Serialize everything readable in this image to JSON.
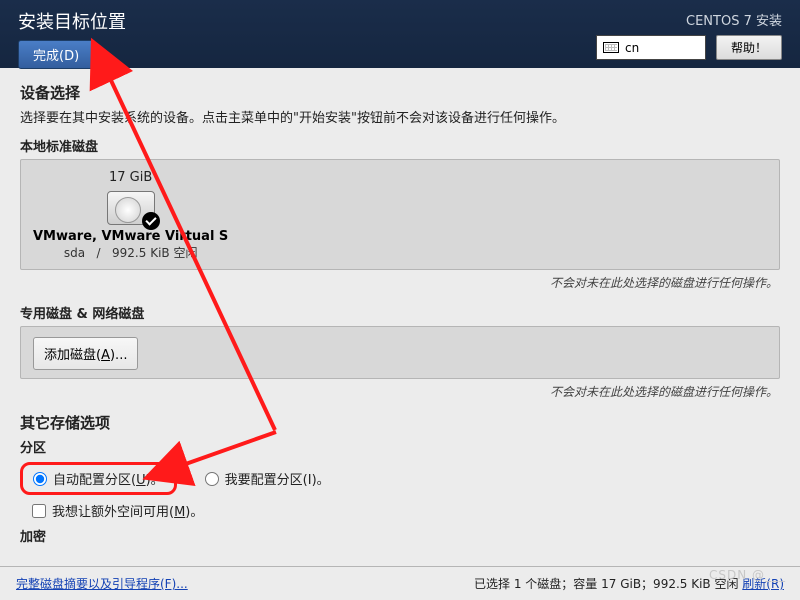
{
  "header": {
    "title": "安装目标位置",
    "done": "完成(D)",
    "subtitle": "CENTOS 7 安装",
    "lang": "cn",
    "help": "帮助！"
  },
  "device": {
    "head": "设备选择",
    "desc": "选择要在其中安装系统的设备。点击主菜单中的\"开始安装\"按钮前不会对该设备进行任何操作。",
    "local_head": "本地标准磁盘",
    "disk_size": "17 GiB",
    "disk_name": "VMware, VMware Virtual S",
    "disk_dev": "sda",
    "disk_sep": "/",
    "disk_free": "992.5 KiB 空闲",
    "note": "不会对未在此处选择的磁盘进行任何操作。",
    "net_head": "专用磁盘 & 网络磁盘",
    "add_label_pre": "添加磁盘(",
    "add_key": "A",
    "add_label_post": ")..."
  },
  "other": {
    "head": "其它存储选项",
    "part": "分区",
    "auto_pre": "自动配置分区(",
    "auto_key": "U",
    "auto_post": ")。",
    "manual": "我要配置分区(I)。",
    "extra_pre": "我想让额外空间可用(",
    "extra_key": "M",
    "extra_post": ")。",
    "enc": "加密"
  },
  "footer": {
    "full_link": "完整磁盘摘要以及引导程序(F)...",
    "status": "已选择 1 个磁盘；容量 17 GiB；992.5 KiB 空闲 ",
    "refresh": "刷新(R)"
  },
  "watermark": "CSDN @___"
}
